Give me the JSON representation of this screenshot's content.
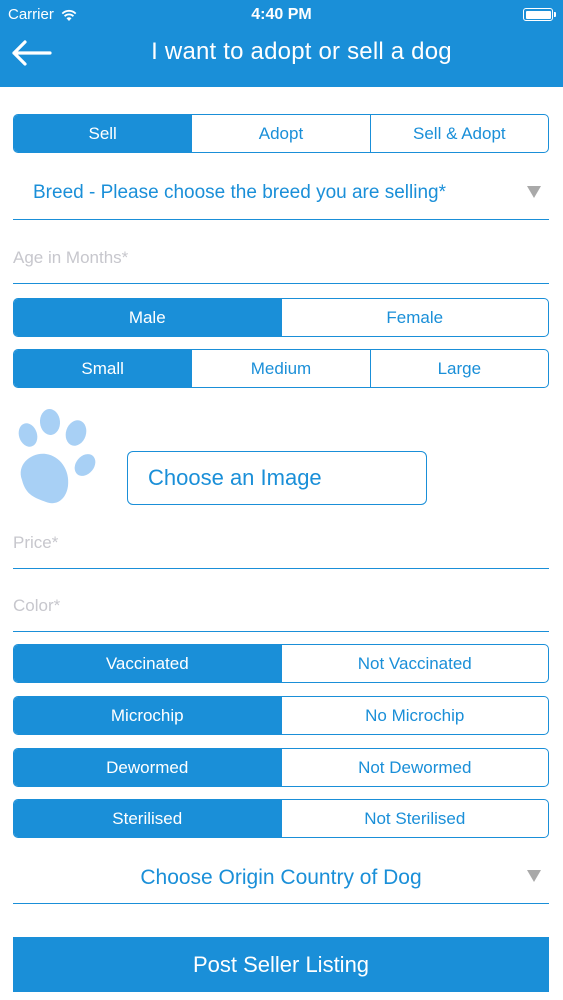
{
  "status_bar": {
    "carrier": "Carrier",
    "time": "4:40 PM"
  },
  "nav": {
    "title": "I want to adopt or sell a dog"
  },
  "listing_type": {
    "options": [
      "Sell",
      "Adopt",
      "Sell & Adopt"
    ],
    "selected": "Sell"
  },
  "breed_dropdown": {
    "label": "Breed - Please choose the breed you are selling*"
  },
  "age_field": {
    "placeholder": "Age in Months*",
    "value": ""
  },
  "gender": {
    "options": [
      "Male",
      "Female"
    ],
    "selected": "Male"
  },
  "size": {
    "options": [
      "Small",
      "Medium",
      "Large"
    ],
    "selected": "Small"
  },
  "image": {
    "button_label": "Choose an Image",
    "icon": "paw-icon"
  },
  "price_field": {
    "placeholder": "Price*",
    "value": ""
  },
  "color_field": {
    "placeholder": "Color*",
    "value": ""
  },
  "vaccination": {
    "options": [
      "Vaccinated",
      "Not Vaccinated"
    ],
    "selected": "Vaccinated"
  },
  "microchip": {
    "options": [
      "Microchip",
      "No Microchip"
    ],
    "selected": "Microchip"
  },
  "deworming": {
    "options": [
      "Dewormed",
      "Not Dewormed"
    ],
    "selected": "Dewormed"
  },
  "sterilisation": {
    "options": [
      "Sterilised",
      "Not Sterilised"
    ],
    "selected": "Sterilised"
  },
  "origin_dropdown": {
    "label": "Choose Origin Country of Dog"
  },
  "submit": {
    "label": "Post Seller Listing"
  },
  "colors": {
    "accent": "#1a8fd8",
    "paw": "#a8d0f5",
    "placeholder": "#c7c7cd",
    "chevron": "#a9a9a9"
  }
}
